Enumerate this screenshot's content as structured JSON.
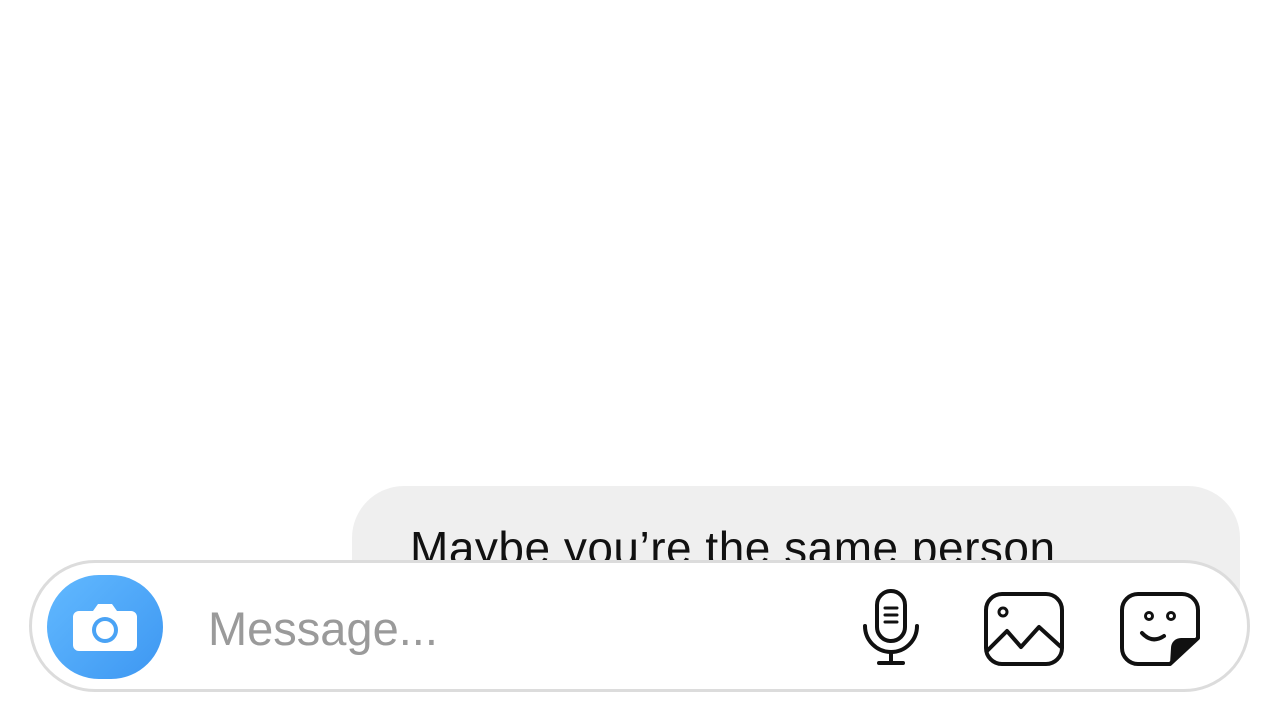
{
  "thread": {
    "messages": [
      {
        "sender": "other",
        "text": "Maybe you’re the same person"
      }
    ]
  },
  "composer": {
    "placeholder": "Message...",
    "value": "",
    "camera_icon": "camera-icon",
    "mic_icon": "microphone-icon",
    "gallery_icon": "gallery-icon",
    "sticker_icon": "sticker-icon",
    "accent_color": "#3d97f2"
  }
}
